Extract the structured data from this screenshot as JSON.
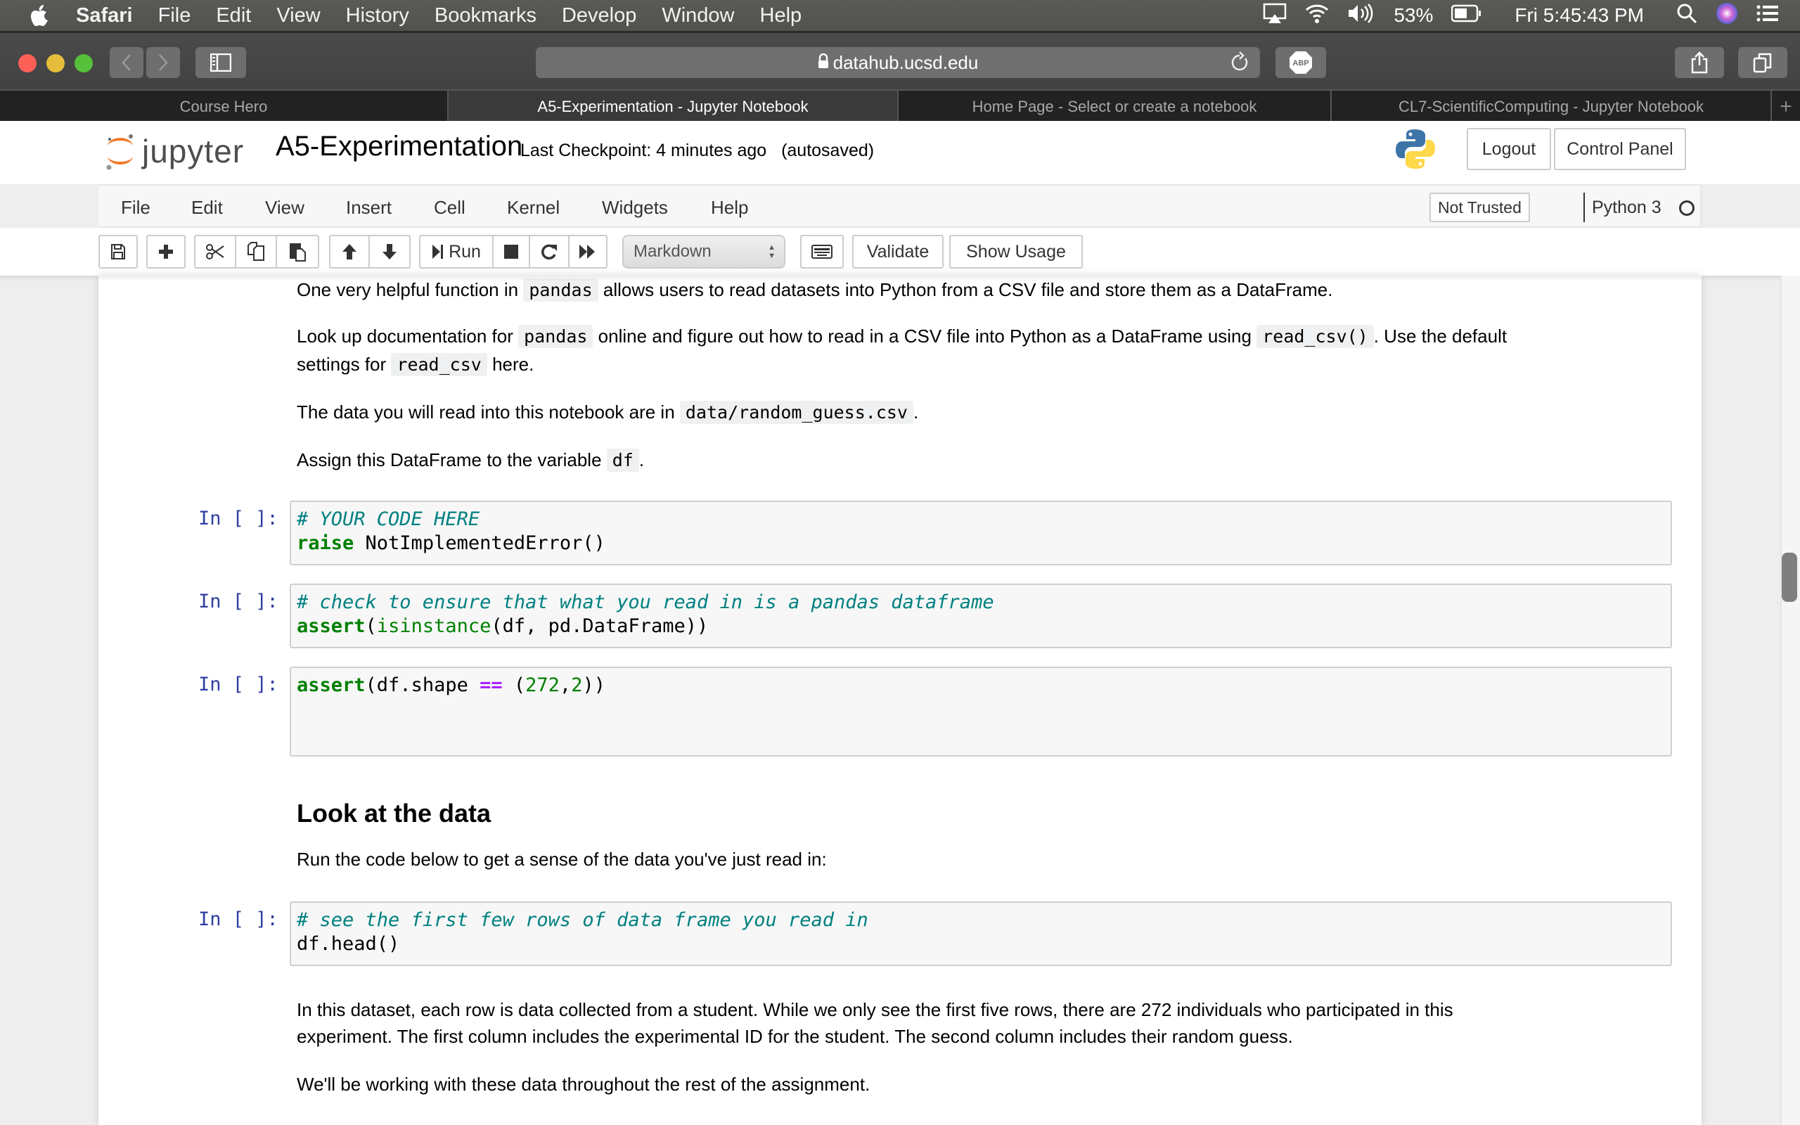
{
  "macos_menubar": {
    "app_name": "Safari",
    "items": [
      "File",
      "Edit",
      "View",
      "History",
      "Bookmarks",
      "Develop",
      "Window",
      "Help"
    ],
    "battery": "53%",
    "clock": "Fri 5:45:43 PM"
  },
  "browser": {
    "url": "datahub.ucsd.edu",
    "adblock_label": "ABP",
    "tabs": [
      {
        "label": "Course Hero",
        "active": false
      },
      {
        "label": "A5-Experimentation - Jupyter Notebook",
        "active": true
      },
      {
        "label": "Home Page - Select or create a notebook",
        "active": false
      },
      {
        "label": "CL7-ScientificComputing - Jupyter Notebook",
        "active": false
      }
    ],
    "new_tab_label": "+"
  },
  "jupyter": {
    "logo_text": "jupyter",
    "notebook_title": "A5-Experimentation",
    "checkpoint": "Last Checkpoint: 4 minutes ago",
    "autosave": "(autosaved)",
    "logout_label": "Logout",
    "control_panel_label": "Control Panel",
    "menu": [
      "File",
      "Edit",
      "View",
      "Insert",
      "Cell",
      "Kernel",
      "Widgets",
      "Help"
    ],
    "trust_label": "Not Trusted",
    "kernel_name": "Python 3",
    "toolbar": {
      "run_label": "Run",
      "cell_type": "Markdown",
      "validate_label": "Validate",
      "show_usage_label": "Show Usage"
    }
  },
  "notebook": {
    "md1": {
      "p1_a": "One very helpful function in",
      "p1_code": "pandas",
      "p1_b": "allows users to read datasets into Python from a CSV file and store them as a DataFrame.",
      "p2_a": "Look up documentation for",
      "p2_code1": "pandas",
      "p2_b": "online and figure out how to read in a CSV file into Python as a DataFrame using",
      "p2_code2": "read_csv()",
      "p2_c": ". Use the default",
      "p2_d": "settings for",
      "p2_code3": "read_csv",
      "p2_e": "here.",
      "p3_a": "The data you will read into this notebook are in",
      "p3_code": "data/random_guess.csv",
      "p3_b": ".",
      "p4_a": "Assign this DataFrame to the variable",
      "p4_code": "df",
      "p4_b": "."
    },
    "cells": [
      {
        "prompt": "In [ ]:",
        "comment": "# YOUR CODE HERE",
        "kw": "raise",
        "rest": " NotImplementedError()"
      },
      {
        "prompt": "In [ ]:",
        "comment": "# check to ensure that what you read in is a pandas dataframe",
        "kw": "assert",
        "p1": "(",
        "builtin": "isinstance",
        "p2": "(df, pd.DataFrame))"
      },
      {
        "prompt": "In [ ]:",
        "kw": "assert",
        "a": "(df.shape ",
        "op": "==",
        "b": " (",
        "n1": "272",
        "c": ",",
        "n2": "2",
        "d": "))"
      },
      {
        "prompt": "In [ ]:",
        "comment": "# see the first few rows of data frame you read in",
        "line2": "df.head()"
      }
    ],
    "heading": "Look at the data",
    "md2": "Run the code below to get a sense of the data you've just read in:",
    "md3_line1": "In this dataset, each row is data collected from a student. While we only see the first five rows, there are 272 individuals who participated in this",
    "md3_line2": "experiment. The first column includes the experimental ID for the student. The second column includes their random guess.",
    "md4": "We'll be working with these data throughout the rest of the assignment."
  }
}
